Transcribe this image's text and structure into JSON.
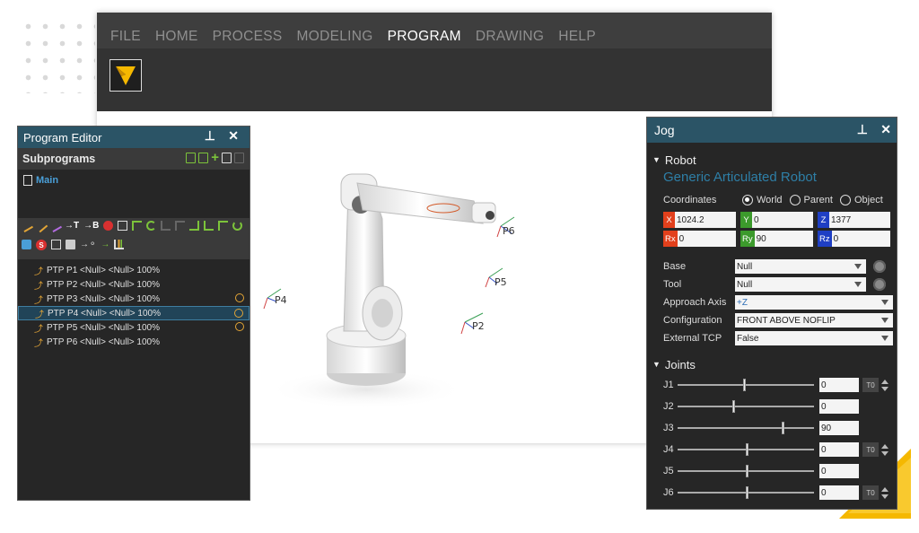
{
  "menu": {
    "items": [
      "FILE",
      "HOME",
      "PROCESS",
      "MODELING",
      "PROGRAM",
      "DRAWING",
      "HELP"
    ],
    "active": "PROGRAM"
  },
  "viewport": {
    "points": [
      "P4",
      "P5",
      "P2",
      "P6"
    ]
  },
  "program_editor": {
    "title": "Program Editor",
    "pin": "📌",
    "close": "✕",
    "subprograms_label": "Subprograms",
    "main_label": "Main",
    "statements": [
      {
        "text": "PTP P1 <Null> <Null> 100%",
        "warn": false,
        "selected": false
      },
      {
        "text": "PTP P2 <Null> <Null> 100%",
        "warn": false,
        "selected": false
      },
      {
        "text": "PTP P3 <Null> <Null> 100%",
        "warn": true,
        "selected": false
      },
      {
        "text": "PTP P4 <Null> <Null> 100%",
        "warn": true,
        "selected": true
      },
      {
        "text": "PTP P5 <Null> <Null> 100%",
        "warn": true,
        "selected": false
      },
      {
        "text": "PTP P6 <Null> <Null> 100%",
        "warn": false,
        "selected": false
      }
    ],
    "toolbar_text": {
      "t": "T",
      "b": "B",
      "s": "S"
    }
  },
  "jog": {
    "title": "Jog",
    "robot_section": "Robot",
    "robot_name": "Generic Articulated Robot",
    "coordinates_label": "Coordinates",
    "coord_options": [
      "World",
      "Parent",
      "Object"
    ],
    "coord_selected": "World",
    "coords": [
      {
        "label": "X",
        "value": "1024.2",
        "color": "#e2401c"
      },
      {
        "label": "Y",
        "value": "0",
        "color": "#3c9a2c"
      },
      {
        "label": "Z",
        "value": "1377",
        "color": "#1f3fc4"
      },
      {
        "label": "Rx",
        "value": "0",
        "color": "#e2401c"
      },
      {
        "label": "Ry",
        "value": "90",
        "color": "#3c9a2c"
      },
      {
        "label": "Rz",
        "value": "0",
        "color": "#1f3fc4"
      }
    ],
    "fields": {
      "base": {
        "label": "Base",
        "value": "Null"
      },
      "tool": {
        "label": "Tool",
        "value": "Null"
      },
      "approach": {
        "label": "Approach Axis",
        "value": "+Z"
      },
      "configuration": {
        "label": "Configuration",
        "value": "FRONT ABOVE NOFLIP"
      },
      "external_tcp": {
        "label": "External TCP",
        "value": "False"
      }
    },
    "joints_section": "Joints",
    "joints": [
      {
        "label": "J1",
        "value": "0",
        "fraction": 0.48,
        "to": true
      },
      {
        "label": "J2",
        "value": "0",
        "fraction": 0.4,
        "to": false
      },
      {
        "label": "J3",
        "value": "90",
        "fraction": 0.76,
        "to": false
      },
      {
        "label": "J4",
        "value": "0",
        "fraction": 0.5,
        "to": true
      },
      {
        "label": "J5",
        "value": "0",
        "fraction": 0.5,
        "to": false
      },
      {
        "label": "J6",
        "value": "0",
        "fraction": 0.5,
        "to": true
      }
    ],
    "to_label": "T0"
  },
  "colors": {
    "titlebar": "#2b5466",
    "accent_yellow": "#f5b800",
    "green": "#7cc33a",
    "orange": "#e3a536"
  }
}
